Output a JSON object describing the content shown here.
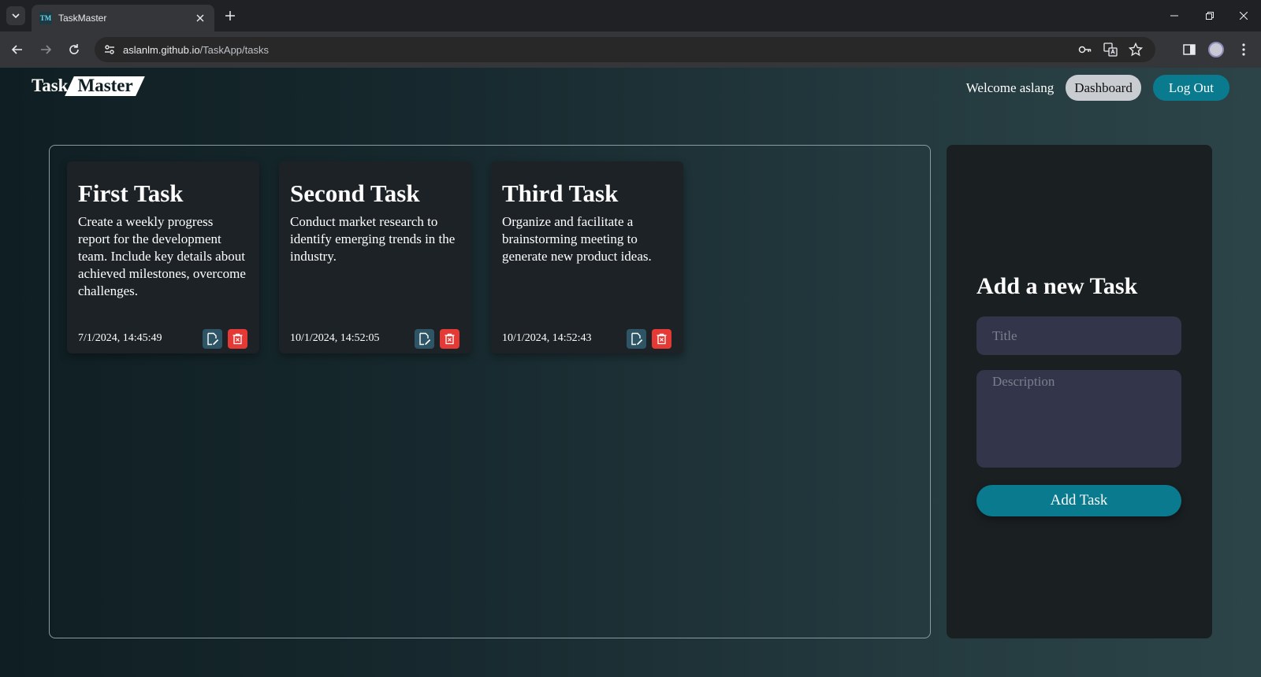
{
  "browser": {
    "tab_title": "TaskMaster",
    "tab_favicon_text": "TM",
    "url_host": "aslanlm.github.io",
    "url_path": "/TaskApp/tasks",
    "icons": [
      "tab-search-icon",
      "close-icon",
      "plus-icon",
      "minimize-icon",
      "restore-icon",
      "close-window-icon",
      "back-icon",
      "forward-icon",
      "reload-icon",
      "site-info-icon",
      "key-icon",
      "translate-icon",
      "star-icon",
      "side-panel-icon",
      "profile-avatar",
      "menu-icon"
    ]
  },
  "header": {
    "logo_task": "Task",
    "logo_master": "Master",
    "welcome": "Welcome aslang",
    "dashboard_label": "Dashboard",
    "logout_label": "Log Out"
  },
  "tasks": [
    {
      "title": "First Task",
      "description": "Create a weekly progress report for the development team. Include key details about achieved milestones, overcome challenges.",
      "date": "7/1/2024, 14:45:49"
    },
    {
      "title": "Second Task",
      "description": "Conduct market research to identify emerging trends in the industry.",
      "date": "10/1/2024, 14:52:05"
    },
    {
      "title": "Third Task",
      "description": "Organize and facilitate a brainstorming meeting to generate new product ideas.",
      "date": "10/1/2024, 14:52:43"
    }
  ],
  "add_form": {
    "heading": "Add a new Task",
    "title_placeholder": "Title",
    "title_value": "",
    "description_placeholder": "Description",
    "description_value": "",
    "submit_label": "Add Task"
  },
  "colors": {
    "accent": "#0a7a8e",
    "delete": "#e53935",
    "edit": "#2d5566",
    "card_bg": "#1c2226",
    "input_bg": "#33354a"
  }
}
